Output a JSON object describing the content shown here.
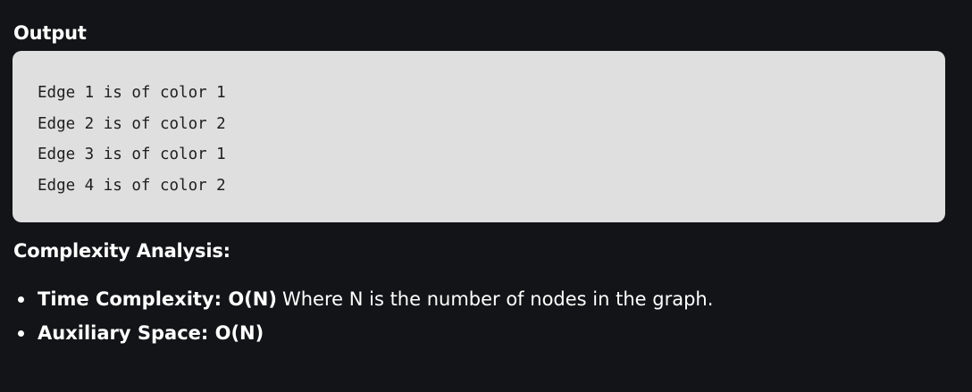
{
  "output_heading": "Output",
  "code_lines": [
    "Edge 1 is of color 1",
    "Edge 2 is of color 2",
    "Edge 3 is of color 1",
    "Edge 4 is of color 2"
  ],
  "analysis_heading": "Complexity Analysis:",
  "bullets": [
    {
      "bold": "Time Complexity: O(N)",
      "text": "Where N is the number of nodes in the graph."
    },
    {
      "bold": "Auxiliary Space: O(N)",
      "text": ""
    }
  ],
  "colors": {
    "background": "#131417",
    "code_background": "#dfdfdf",
    "text": "#ffffff",
    "code_text": "#1e1e1e"
  }
}
